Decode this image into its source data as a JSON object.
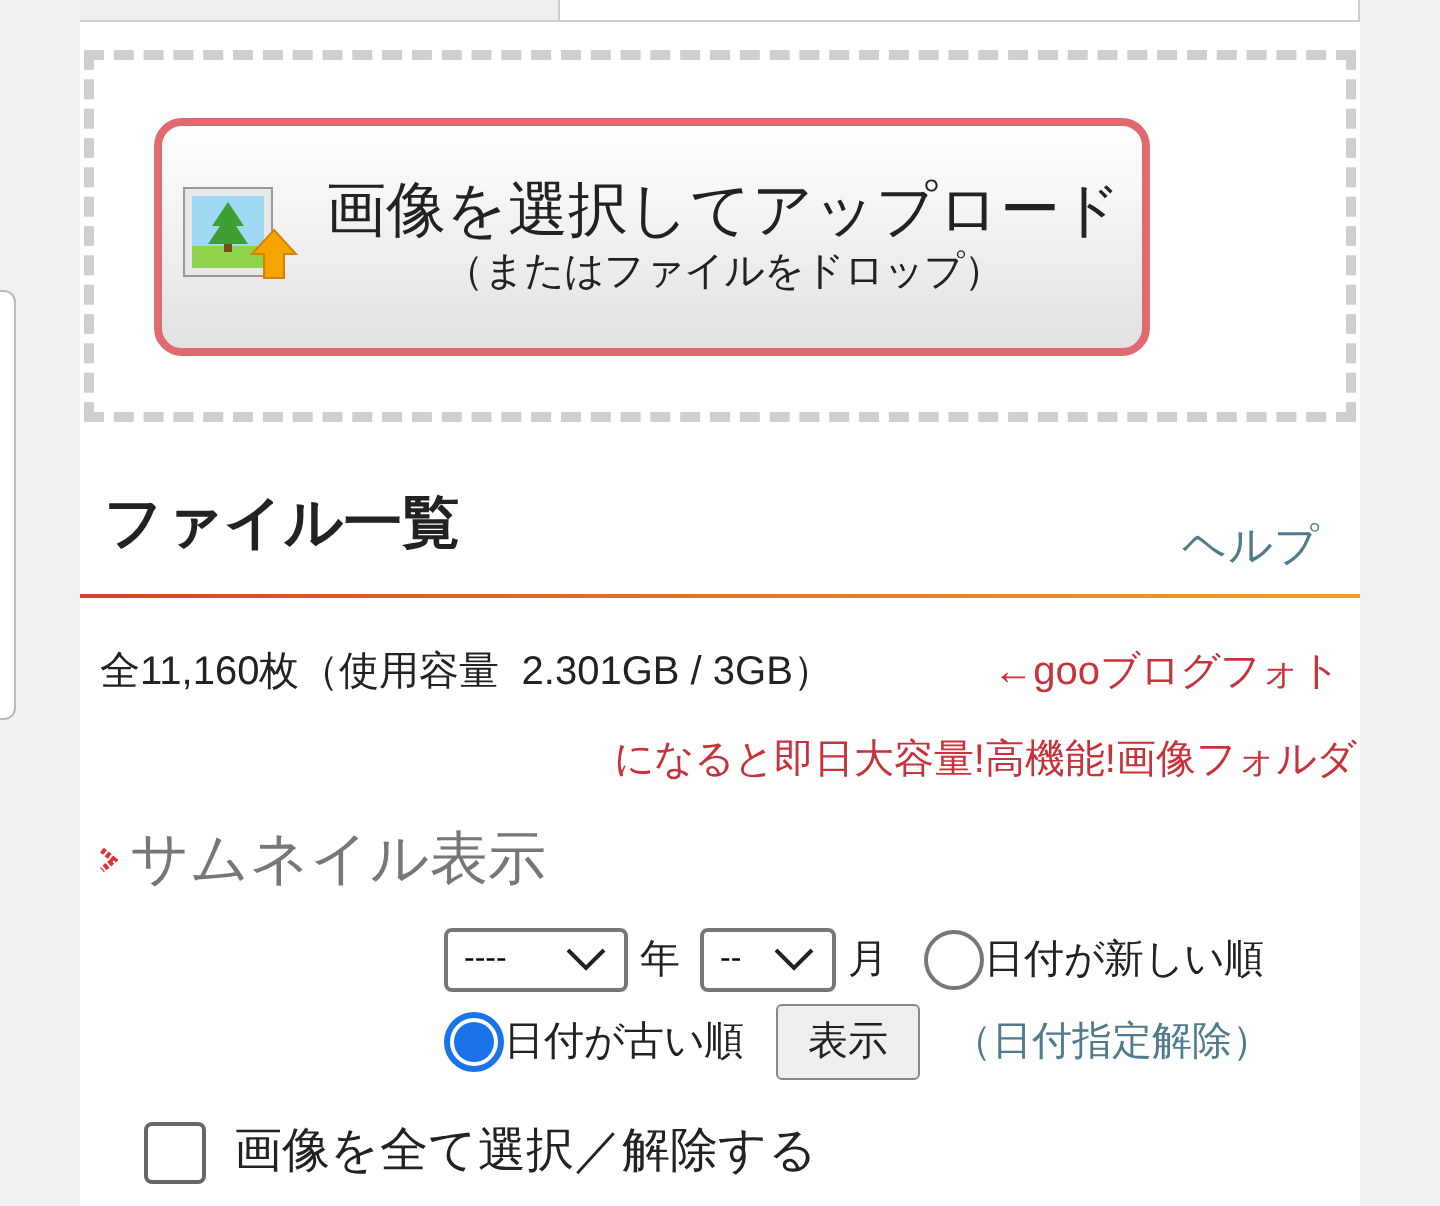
{
  "upload_button": {
    "title": "画像を選択してアップロード",
    "subtitle": "（またはファイルをドロップ）"
  },
  "file_list": {
    "heading": "ファイル一覧",
    "help_link": "ヘルプ",
    "summary": "全11,160枚（使用容量  2.301GB / 3GB）",
    "promo_lines": [
      "←gooブログフォト",
      "になると即日大容量!高機能!画像フォルダ"
    ],
    "thumbnail_toggle": "サムネイル表示",
    "filter": {
      "year_select": "----",
      "year_label": "年",
      "month_select": "--",
      "month_label": "月",
      "sort_options": [
        {
          "label": "日付が新しい順",
          "selected": false
        },
        {
          "label": "日付が古い順",
          "selected": true
        }
      ],
      "show_button": "表示",
      "clear_link": "（日付指定解除）"
    },
    "select_all": {
      "label": "画像を全て選択／解除する",
      "checked": false
    }
  }
}
